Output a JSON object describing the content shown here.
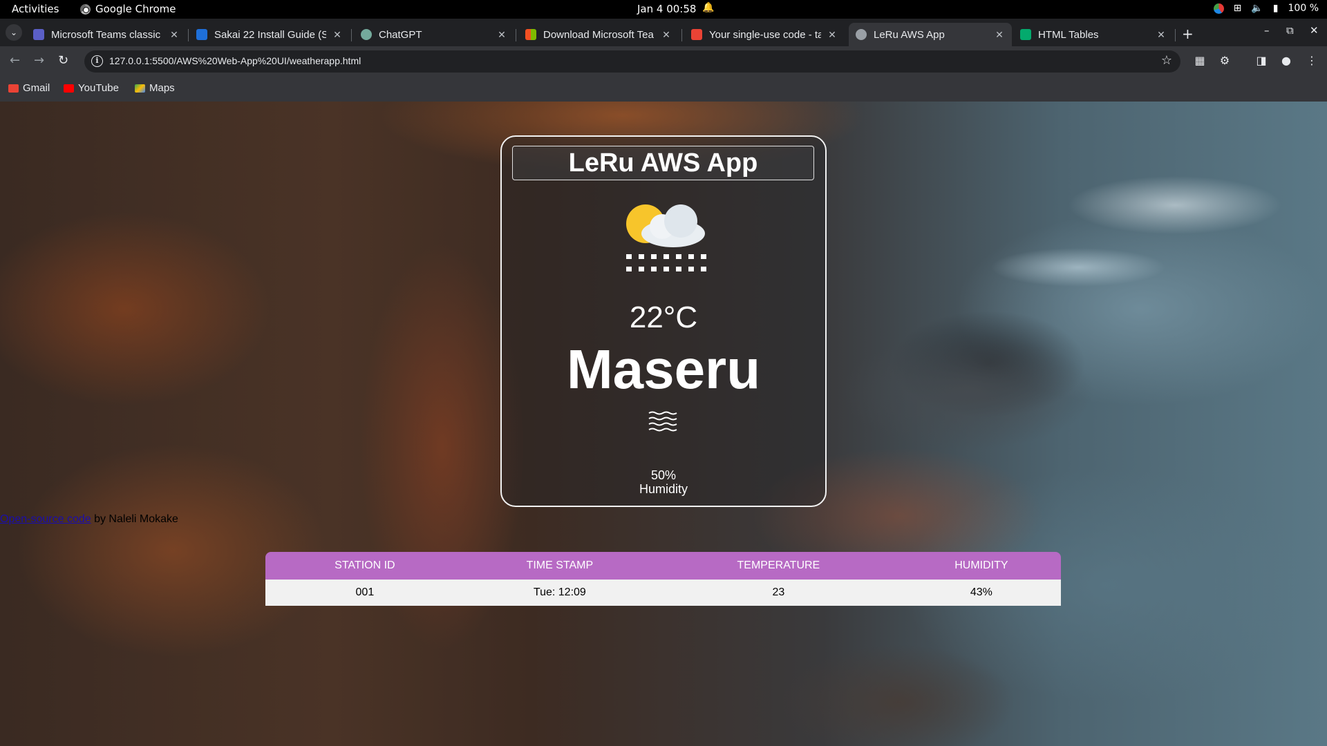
{
  "system_bar": {
    "activities": "Activities",
    "app_name": "Google Chrome",
    "clock": "Jan 4  00:58",
    "battery": "100 %"
  },
  "tabs": [
    {
      "title": "Microsoft Teams classic",
      "favicon_color": "#5b5fc7"
    },
    {
      "title": "Sakai 22 Install Guide (Sc",
      "favicon_color": "#1e6fd9"
    },
    {
      "title": "ChatGPT",
      "favicon_color": "#74aa9c"
    },
    {
      "title": "Download Microsoft Tea",
      "favicon_color": "#f25022"
    },
    {
      "title": "Your single-use code - ta",
      "favicon_color": "#ea4335"
    },
    {
      "title": "LeRu AWS App",
      "favicon_color": "#9aa0a6",
      "active": true
    },
    {
      "title": "HTML Tables",
      "favicon_color": "#04aa6d"
    }
  ],
  "address_bar": {
    "url": "127.0.0.1:5500/AWS%20Web-App%20UI/weatherapp.html"
  },
  "bookmarks": [
    {
      "label": "Gmail",
      "color": "#ea4335"
    },
    {
      "label": "YouTube",
      "color": "#ff0000"
    },
    {
      "label": "Maps",
      "color": "#34a853"
    }
  ],
  "weather_card": {
    "title": "LeRu AWS App",
    "weather_icon": "sun-cloud-snow-icon",
    "temperature": "22°C",
    "city": "Maseru",
    "humidity_icon": "humidity-waves-icon",
    "humidity_value": "50%",
    "humidity_label": "Humidity"
  },
  "credit": {
    "link_text": "Open-source code",
    "suffix": " by Naleli Mokake"
  },
  "table": {
    "header_color": "#b76ac4",
    "headers": [
      "STATION ID",
      "TIME STAMP",
      "TEMPERATURE",
      "HUMIDITY"
    ],
    "rows": [
      [
        "001",
        "Tue: 12:09",
        "23",
        "43%"
      ]
    ]
  }
}
